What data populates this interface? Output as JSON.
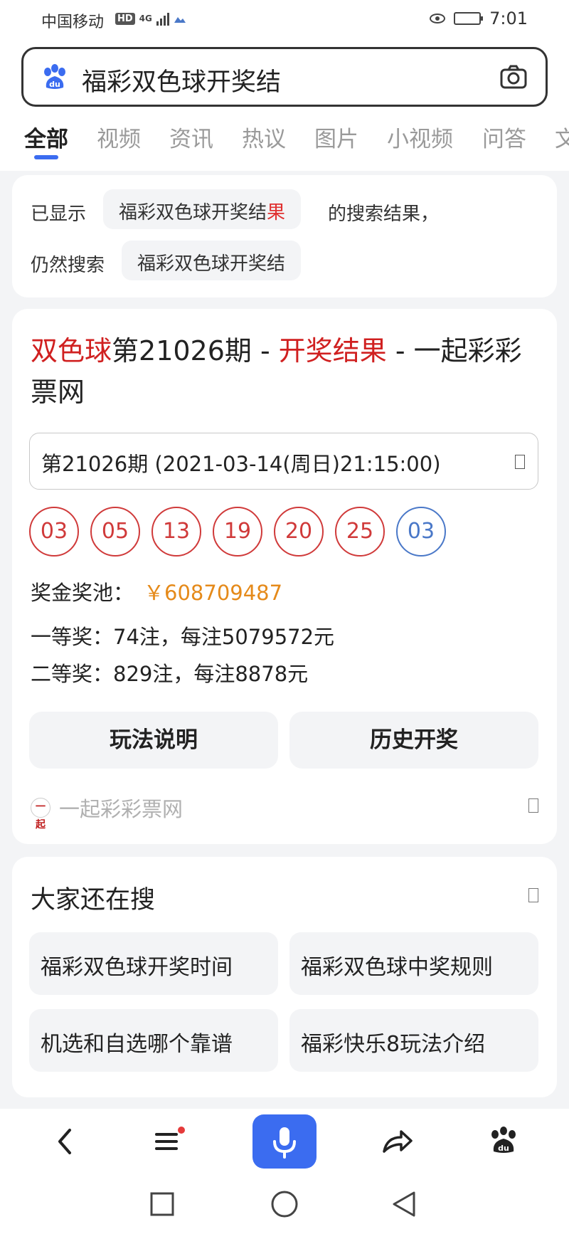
{
  "status_bar": {
    "carrier": "中国移动",
    "hd": "HD",
    "network": "4G",
    "time": "7:01"
  },
  "search": {
    "query": "福彩双色球开奖结",
    "left_icon": "baidu-paw-icon",
    "right_icon": "camera-icon"
  },
  "tabs": [
    {
      "label": "全部",
      "active": true
    },
    {
      "label": "视频"
    },
    {
      "label": "资讯"
    },
    {
      "label": "热议"
    },
    {
      "label": "图片"
    },
    {
      "label": "小视频"
    },
    {
      "label": "问答"
    },
    {
      "label": "文"
    }
  ],
  "correction": {
    "prefix": "已显示",
    "shown_query_main": "福彩双色球开奖结",
    "shown_query_highlight": "果",
    "suffix": "的搜索结果，",
    "still_search_label": "仍然搜索",
    "original_query": "福彩双色球开奖结"
  },
  "result": {
    "title_part1": "双色球",
    "title_part2": "第21026期 - ",
    "title_part3": "开奖结果",
    "title_part4": " - 一起彩彩票网",
    "draw_selector": "第21026期 (2021-03-14(周日)21:15:00)",
    "red_balls": [
      "03",
      "05",
      "13",
      "19",
      "20",
      "25"
    ],
    "blue_ball": "03",
    "pool_label": "奖金奖池：",
    "pool_amount": "￥608709487",
    "first_prize": "一等奖：74注，每注5079572元",
    "second_prize": "二等奖：829注，每注8878元",
    "buttons": {
      "rules": "玩法说明",
      "history": "历史开奖"
    },
    "source_logo_text": "一起",
    "source_name": "一起彩彩票网"
  },
  "related": {
    "heading": "大家还在搜",
    "items": [
      "福彩双色球开奖时间",
      "福彩双色球中奖规则",
      "机选和自选哪个靠谱",
      "福彩快乐8玩法介绍"
    ]
  },
  "colors": {
    "highlight_red": "#d02020",
    "ball_red": "#d03a3a",
    "ball_blue": "#4a78c8",
    "pool_orange": "#e58a1a",
    "accent_blue": "#3b6cf0"
  }
}
